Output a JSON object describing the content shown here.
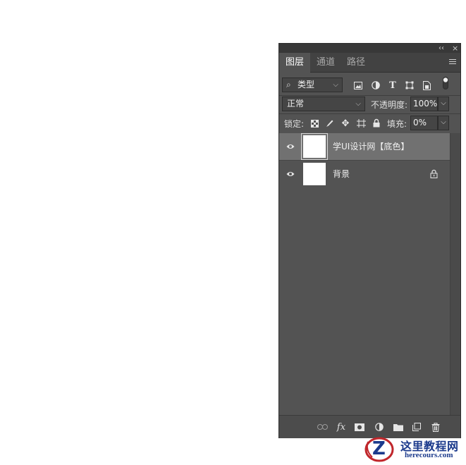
{
  "window": {
    "collapse_glyph": "‹‹",
    "close_glyph": "×"
  },
  "tabs": [
    {
      "label": "图层",
      "active": true
    },
    {
      "label": "通道",
      "active": false
    },
    {
      "label": "路径",
      "active": false
    }
  ],
  "filter": {
    "search_glyph": "⌕",
    "kind_label": "类型",
    "icons": [
      "image-filter-icon",
      "adjustment-filter-icon",
      "type-filter-icon",
      "shape-filter-icon",
      "smart-object-filter-icon",
      "filter-toggle-icon"
    ]
  },
  "blend": {
    "mode": "正常",
    "opacity_label": "不透明度:",
    "opacity_value": "100%"
  },
  "lock": {
    "label": "锁定:",
    "icons": [
      "lock-transparent-icon",
      "lock-image-icon",
      "lock-position-icon",
      "lock-artboard-icon",
      "lock-all-icon"
    ],
    "fill_label": "填充:",
    "fill_value": "0%"
  },
  "layers": [
    {
      "name": "学UI设计网【底色】",
      "visible": true,
      "selected": true,
      "locked": false
    },
    {
      "name": "背景",
      "visible": true,
      "selected": false,
      "locked": true
    }
  ],
  "bottom_icons": [
    "link-layers-icon",
    "fx-icon",
    "add-mask-icon",
    "new-fill-adjustment-icon",
    "new-group-icon",
    "new-layer-icon",
    "delete-layer-icon"
  ],
  "bottom_fx_text": "fx",
  "watermark": {
    "title": "这里教程网",
    "url": "herecours.com",
    "logo_letter": "Z"
  },
  "colors": {
    "panel_bg": "#535353",
    "selected_layer": "#717171",
    "watermark_blue": "#1b3a8c",
    "watermark_red": "#c0262b"
  }
}
